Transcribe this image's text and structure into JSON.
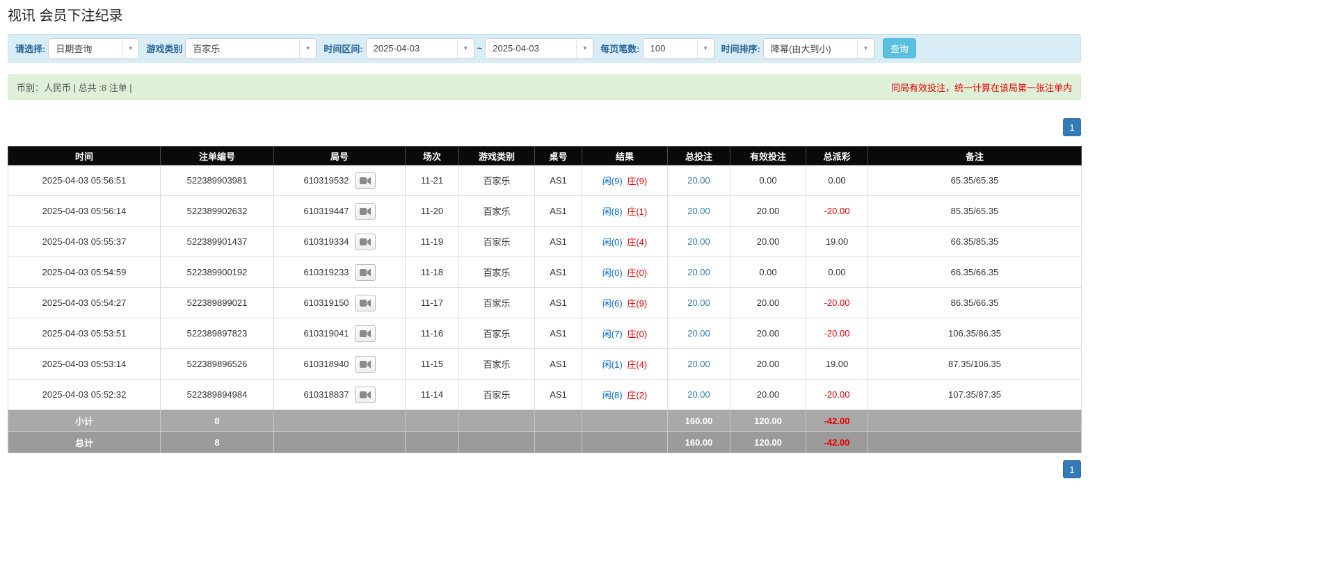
{
  "page": {
    "title": "视讯 会员下注纪录"
  },
  "filters": {
    "select_label": "请选择:",
    "select_value": "日期查询",
    "game_type_label": "游戏类别",
    "game_type_value": "百家乐",
    "time_range_label": "时间区间:",
    "time_from": "2025-04-03",
    "tilde": "~",
    "time_to": "2025-04-03",
    "per_page_label": "每页笔数:",
    "per_page_value": "100",
    "sort_label": "时间排序:",
    "sort_value": "降幂(由大到小)",
    "search_button": "查询"
  },
  "summary": {
    "left": "币别：人民币 | 总共 :8 注单 |",
    "right": "同局有效投注，统一计算在该局第一张注单内"
  },
  "pagination": {
    "page": "1"
  },
  "colors": {
    "accent_blue": "#337ab7",
    "search_button_bg": "#5bc0de",
    "filter_bar_bg": "#d9edf7",
    "summary_bar_bg": "#dff0d8",
    "header_bg": "#0a0a0a",
    "player_blue": "#0066cc",
    "banker_red": "#e60000",
    "negative_red": "#e60000",
    "footer_gray": "#a0a0a0"
  },
  "table": {
    "headers": [
      "时间",
      "注单编号",
      "局号",
      "场次",
      "游戏类别",
      "桌号",
      "结果",
      "总投注",
      "有效投注",
      "总派彩",
      "备注"
    ],
    "rows": [
      {
        "time": "2025-04-03 05:56:51",
        "bet_id": "522389903981",
        "round_id": "610319532",
        "session": "11-21",
        "game_type": "百家乐",
        "table_no": "AS1",
        "result_player": "闲(9)",
        "result_banker": "庄(9)",
        "total_bet": "20.00",
        "valid_bet": "0.00",
        "payout": "0.00",
        "remark": "65.35/65.35"
      },
      {
        "time": "2025-04-03 05:56:14",
        "bet_id": "522389902632",
        "round_id": "610319447",
        "session": "11-20",
        "game_type": "百家乐",
        "table_no": "AS1",
        "result_player": "闲(8)",
        "result_banker": "庄(1)",
        "total_bet": "20.00",
        "valid_bet": "20.00",
        "payout": "-20.00",
        "remark": "85.35/65.35"
      },
      {
        "time": "2025-04-03 05:55:37",
        "bet_id": "522389901437",
        "round_id": "610319334",
        "session": "11-19",
        "game_type": "百家乐",
        "table_no": "AS1",
        "result_player": "闲(0)",
        "result_banker": "庄(4)",
        "total_bet": "20.00",
        "valid_bet": "20.00",
        "payout": "19.00",
        "remark": "66.35/85.35"
      },
      {
        "time": "2025-04-03 05:54:59",
        "bet_id": "522389900192",
        "round_id": "610319233",
        "session": "11-18",
        "game_type": "百家乐",
        "table_no": "AS1",
        "result_player": "闲(0)",
        "result_banker": "庄(0)",
        "total_bet": "20.00",
        "valid_bet": "0.00",
        "payout": "0.00",
        "remark": "66.35/66.35"
      },
      {
        "time": "2025-04-03 05:54:27",
        "bet_id": "522389899021",
        "round_id": "610319150",
        "session": "11-17",
        "game_type": "百家乐",
        "table_no": "AS1",
        "result_player": "闲(6)",
        "result_banker": "庄(9)",
        "total_bet": "20.00",
        "valid_bet": "20.00",
        "payout": "-20.00",
        "remark": "86.35/66.35"
      },
      {
        "time": "2025-04-03 05:53:51",
        "bet_id": "522389897823",
        "round_id": "610319041",
        "session": "11-16",
        "game_type": "百家乐",
        "table_no": "AS1",
        "result_player": "闲(7)",
        "result_banker": "庄(0)",
        "total_bet": "20.00",
        "valid_bet": "20.00",
        "payout": "-20.00",
        "remark": "106.35/86.35"
      },
      {
        "time": "2025-04-03 05:53:14",
        "bet_id": "522389896526",
        "round_id": "610318940",
        "session": "11-15",
        "game_type": "百家乐",
        "table_no": "AS1",
        "result_player": "闲(1)",
        "result_banker": "庄(4)",
        "total_bet": "20.00",
        "valid_bet": "20.00",
        "payout": "19.00",
        "remark": "87.35/106.35"
      },
      {
        "time": "2025-04-03 05:52:32",
        "bet_id": "522389894984",
        "round_id": "610318837",
        "session": "11-14",
        "game_type": "百家乐",
        "table_no": "AS1",
        "result_player": "闲(8)",
        "result_banker": "庄(2)",
        "total_bet": "20.00",
        "valid_bet": "20.00",
        "payout": "-20.00",
        "remark": "107.35/87.35"
      }
    ],
    "subtotal": {
      "label": "小计",
      "count": "8",
      "total_bet": "160.00",
      "valid_bet": "120.00",
      "payout": "-42.00"
    },
    "grandtotal": {
      "label": "总计",
      "count": "8",
      "total_bet": "160.00",
      "valid_bet": "120.00",
      "payout": "-42.00"
    }
  }
}
